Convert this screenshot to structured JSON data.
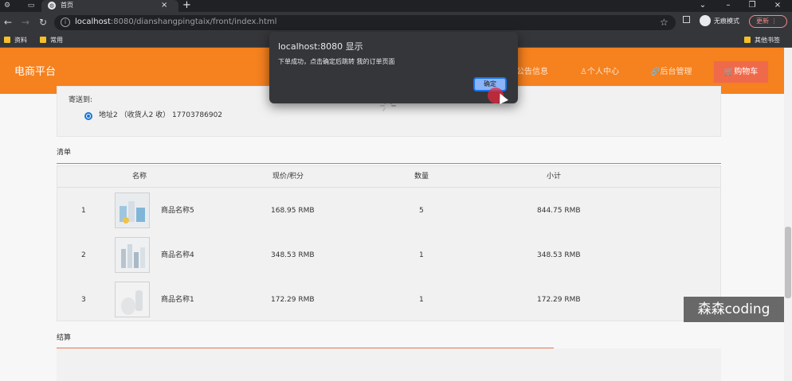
{
  "browser": {
    "tab_title": "首页",
    "url_host": "localhost",
    "url_rest": ":8080/dianshangpingtaix/front/index.html",
    "incognito_label": "无痕模式",
    "update_label": "更新",
    "bookmarks": [
      "资料",
      "常用"
    ],
    "other_bookmarks": "其他书签"
  },
  "header": {
    "brand": "电商平台",
    "nav": [
      "公告信息",
      "个人中心",
      "后台管理"
    ],
    "cart": "购物车",
    "colors": {
      "header": "#f5811f",
      "cart": "#ef6a4a",
      "accent_line": "#e8744c"
    }
  },
  "address": {
    "label": "寄送到:",
    "selected": "地址2 （收货人2 收） 17703786902"
  },
  "list": {
    "title": "清单",
    "columns": [
      "名称",
      "现价/积分",
      "数量",
      "小计"
    ],
    "rows": [
      {
        "index": "1",
        "name": "商品名称5",
        "price": "168.95 RMB",
        "qty": "5",
        "subtotal": "844.75 RMB"
      },
      {
        "index": "2",
        "name": "商品名称4",
        "price": "348.53 RMB",
        "qty": "1",
        "subtotal": "348.53 RMB"
      },
      {
        "index": "3",
        "name": "商品名称1",
        "price": "172.29 RMB",
        "qty": "1",
        "subtotal": "172.29 RMB"
      }
    ]
  },
  "settle": {
    "title": "结算"
  },
  "dialog": {
    "title": "localhost:8080 显示",
    "message": "下单成功，点击确定后跳转 我的订单页面",
    "ok": "确定"
  },
  "watermark": "森森coding"
}
